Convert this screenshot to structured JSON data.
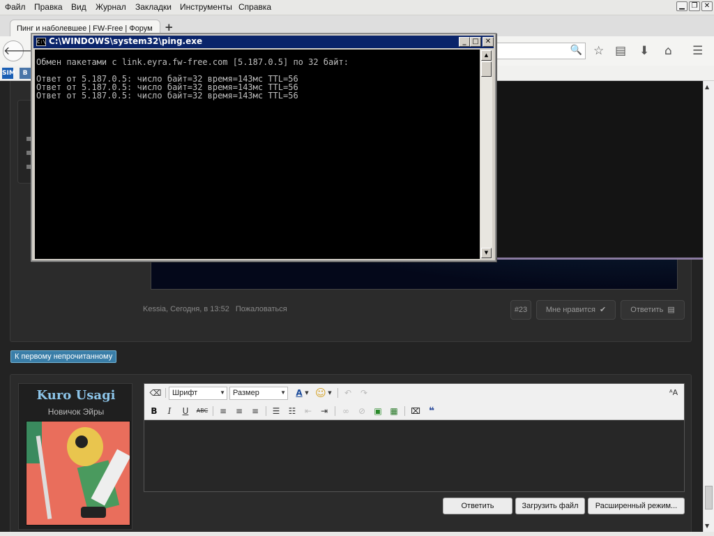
{
  "browser": {
    "menu": [
      "Файл",
      "Правка",
      "Вид",
      "Журнал",
      "Закладки",
      "Инструменты",
      "Справка"
    ],
    "tab_title": "Пинг и наболевшее | FW-Free | Форум",
    "new_tab": "+",
    "bookmarks": [
      {
        "label": "SIM",
        "color": "#1a5fb4"
      },
      {
        "label": "В",
        "color": "#4a76a8"
      }
    ]
  },
  "console": {
    "title": "C:\\WINDOWS\\system32\\ping.exe",
    "icon_label": "C:\\",
    "lines": [
      "Обмен пакетами с link.eyra.fw-free.com [5.187.0.5] по 32 байт:",
      "",
      "Ответ от 5.187.0.5: число байт=32 время=143мс TTL=56",
      "Ответ от 5.187.0.5: число байт=32 время=143мс TTL=56",
      "Ответ от 5.187.0.5: число байт=32 время=143мс TTL=56"
    ]
  },
  "post": {
    "author_time": "Kessia, Сегодня, в 13:52",
    "report": "Пожаловаться",
    "number": "#23",
    "like": "Мне нравится",
    "reply": "Ответить"
  },
  "unread_button": "К первому непрочитанному",
  "reply_form": {
    "user_name": "Kuro Usagi",
    "user_title": "Новичок Эйры",
    "font_select": "Шрифт",
    "size_select": "Размер",
    "toolbar_bold": "B",
    "toolbar_italic": "I",
    "toolbar_underline": "U",
    "toolbar_strike": "ABC",
    "submit": "Ответить",
    "upload": "Загрузить файл",
    "advanced": "Расширенный режим..."
  }
}
